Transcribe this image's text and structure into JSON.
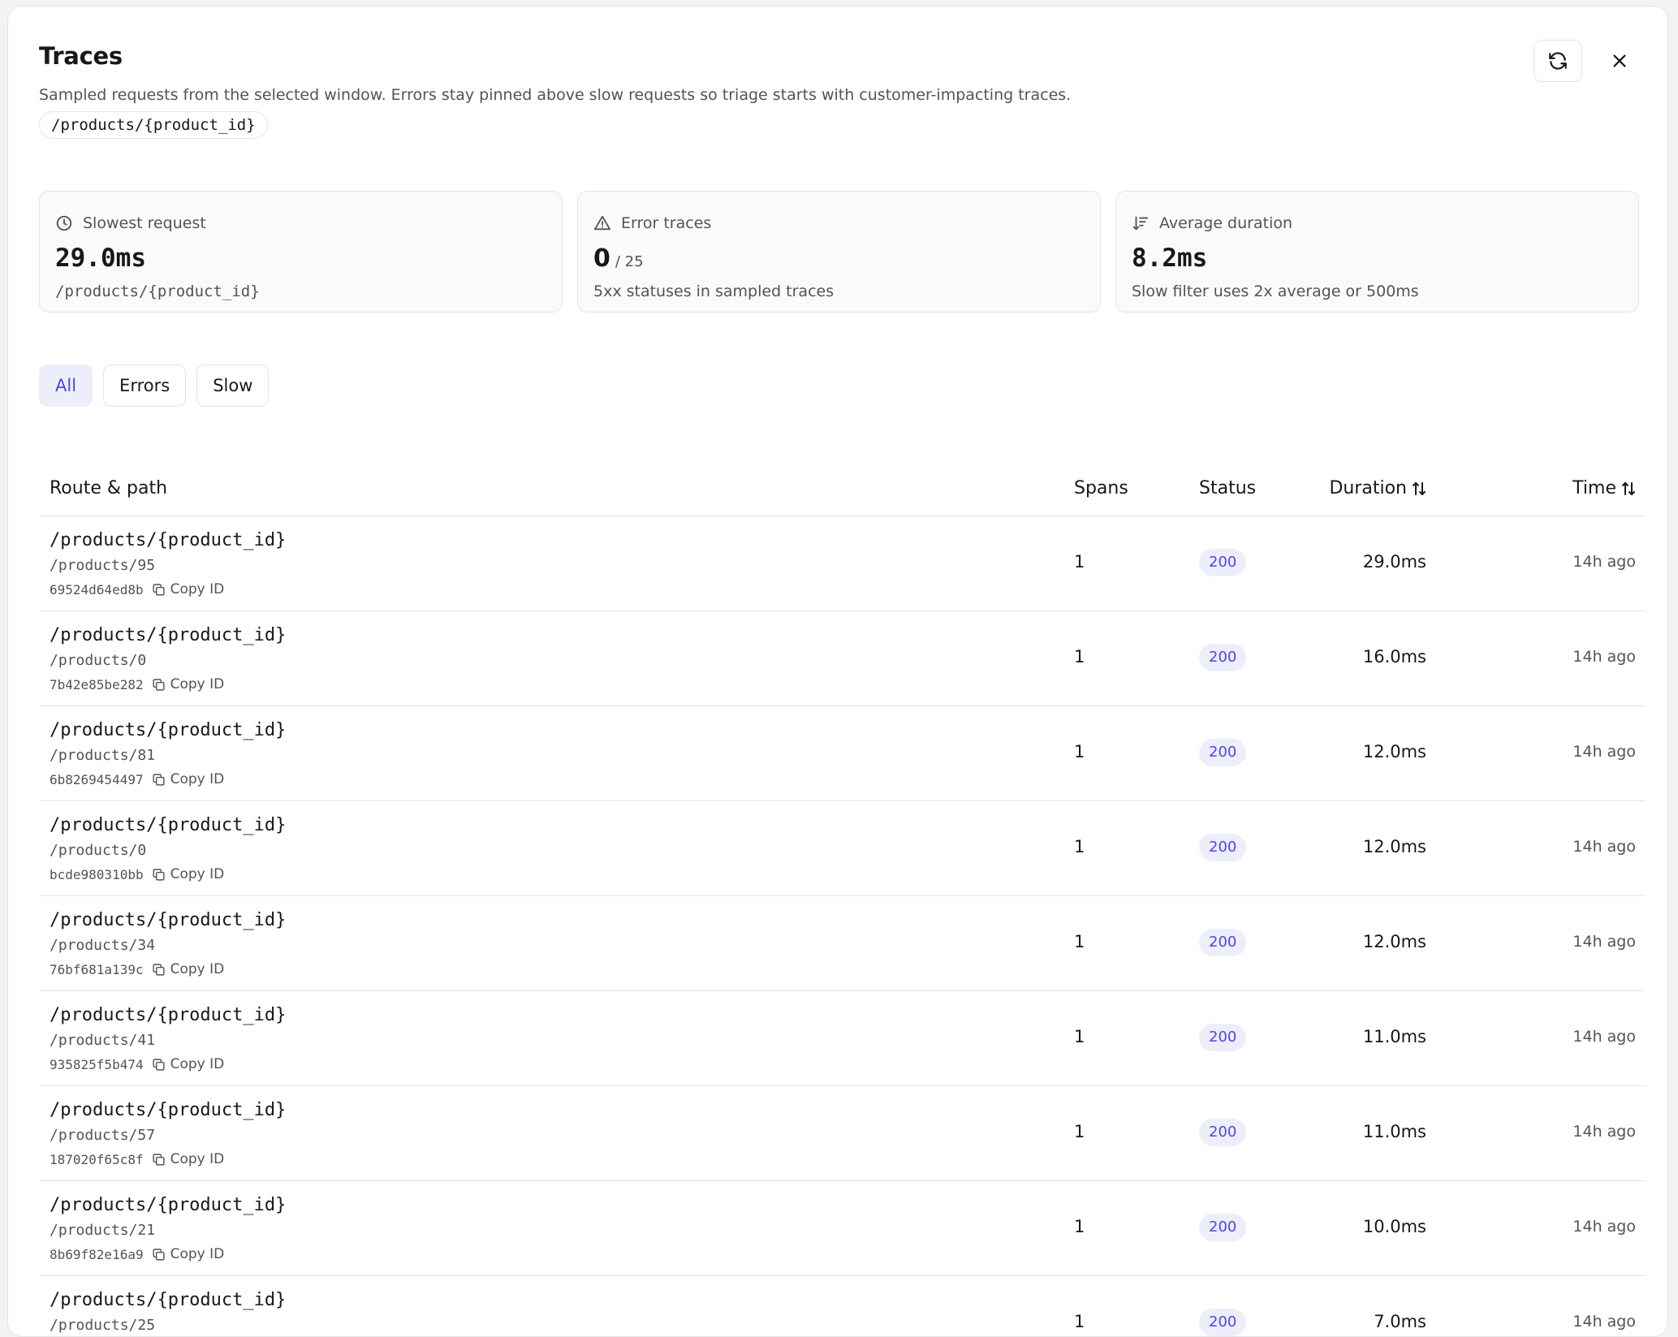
{
  "header": {
    "title": "Traces",
    "subtitle": "Sampled requests from the selected window. Errors stay pinned above slow requests so triage starts with customer-impacting traces.",
    "route_chip": "/products/{product_id}",
    "refresh_icon": "refresh-icon",
    "close_icon": "close-icon"
  },
  "cards": {
    "slowest": {
      "icon": "clock-icon",
      "label": "Slowest request",
      "value": "29.0ms",
      "detail": "/products/{product_id}"
    },
    "errors": {
      "icon": "warning-icon",
      "label": "Error traces",
      "value": "0",
      "total": "/ 25",
      "detail": "5xx statuses in sampled traces"
    },
    "average": {
      "icon": "sort-descending-icon",
      "label": "Average duration",
      "value": "8.2ms",
      "detail": "Slow filter uses 2x average or 500ms"
    }
  },
  "filters": {
    "all": "All",
    "errors": "Errors",
    "slow": "Slow",
    "active": "All"
  },
  "table": {
    "columns": {
      "route": "Route & path",
      "spans": "Spans",
      "status": "Status",
      "duration": "Duration",
      "time": "Time"
    },
    "copy_label": "Copy ID",
    "rows": [
      {
        "route": "/products/{product_id}",
        "path": "/products/95",
        "id": "69524d64ed8b",
        "spans": "1",
        "status": "200",
        "duration": "29.0ms",
        "time": "14h ago"
      },
      {
        "route": "/products/{product_id}",
        "path": "/products/0",
        "id": "7b42e85be282",
        "spans": "1",
        "status": "200",
        "duration": "16.0ms",
        "time": "14h ago"
      },
      {
        "route": "/products/{product_id}",
        "path": "/products/81",
        "id": "6b8269454497",
        "spans": "1",
        "status": "200",
        "duration": "12.0ms",
        "time": "14h ago"
      },
      {
        "route": "/products/{product_id}",
        "path": "/products/0",
        "id": "bcde980310bb",
        "spans": "1",
        "status": "200",
        "duration": "12.0ms",
        "time": "14h ago"
      },
      {
        "route": "/products/{product_id}",
        "path": "/products/34",
        "id": "76bf681a139c",
        "spans": "1",
        "status": "200",
        "duration": "12.0ms",
        "time": "14h ago"
      },
      {
        "route": "/products/{product_id}",
        "path": "/products/41",
        "id": "935825f5b474",
        "spans": "1",
        "status": "200",
        "duration": "11.0ms",
        "time": "14h ago"
      },
      {
        "route": "/products/{product_id}",
        "path": "/products/57",
        "id": "187020f65c8f",
        "spans": "1",
        "status": "200",
        "duration": "11.0ms",
        "time": "14h ago"
      },
      {
        "route": "/products/{product_id}",
        "path": "/products/21",
        "id": "8b69f82e16a9",
        "spans": "1",
        "status": "200",
        "duration": "10.0ms",
        "time": "14h ago"
      },
      {
        "route": "/products/{product_id}",
        "path": "/products/25",
        "id": "",
        "spans": "1",
        "status": "200",
        "duration": "7.0ms",
        "time": "14h ago"
      }
    ]
  },
  "colors": {
    "accent": "#4f46e5",
    "accent_bg": "#eeeefb",
    "border": "#e4e4e7",
    "muted_text": "#52525b"
  }
}
